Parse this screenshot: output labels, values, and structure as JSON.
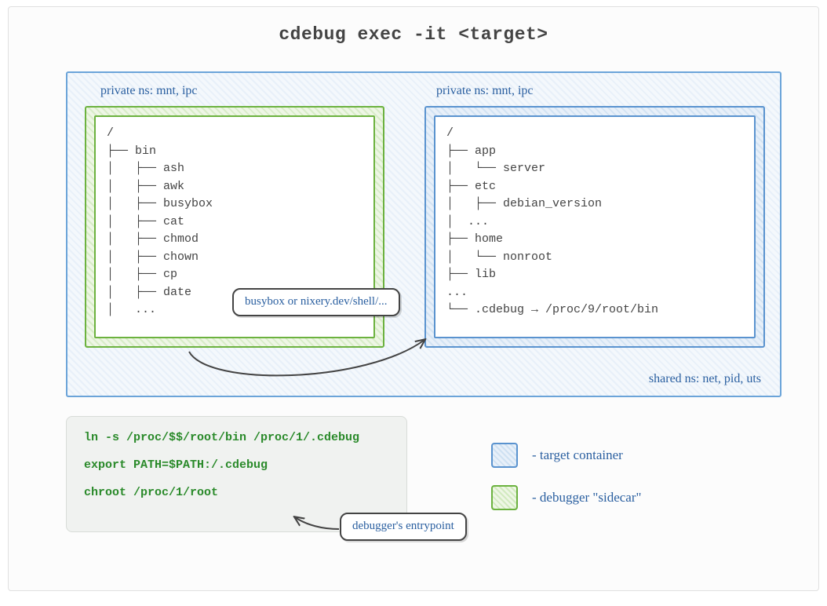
{
  "title": "cdebug exec -it <target>",
  "shared_ns_label": "shared ns:  net, pid, uts",
  "debugger": {
    "ns_label": "private ns:  mnt, ipc",
    "tree": "/\n├── bin\n│   ├── ash\n│   ├── awk\n│   ├── busybox\n│   ├── cat\n│   ├── chmod\n│   ├── chown\n│   ├── cp\n│   ├── date\n│   ...",
    "callout": "busybox or\nnixery.dev/shell/..."
  },
  "target": {
    "ns_label": "private ns:  mnt, ipc",
    "tree": "/\n├── app\n│   └── server\n├── etc\n│   ├── debian_version\n│  ...\n├── home\n│   └── nonroot\n├── lib\n...\n└── .cdebug → /proc/9/root/bin"
  },
  "entrypoint": {
    "lines": [
      "ln -s /proc/$$/root/bin /proc/1/.cdebug",
      "export PATH=$PATH:/.cdebug",
      "chroot /proc/1/root"
    ],
    "callout": "debugger's\nentrypoint"
  },
  "legend": {
    "target": "- target container",
    "sidecar": "- debugger \"sidecar\""
  }
}
